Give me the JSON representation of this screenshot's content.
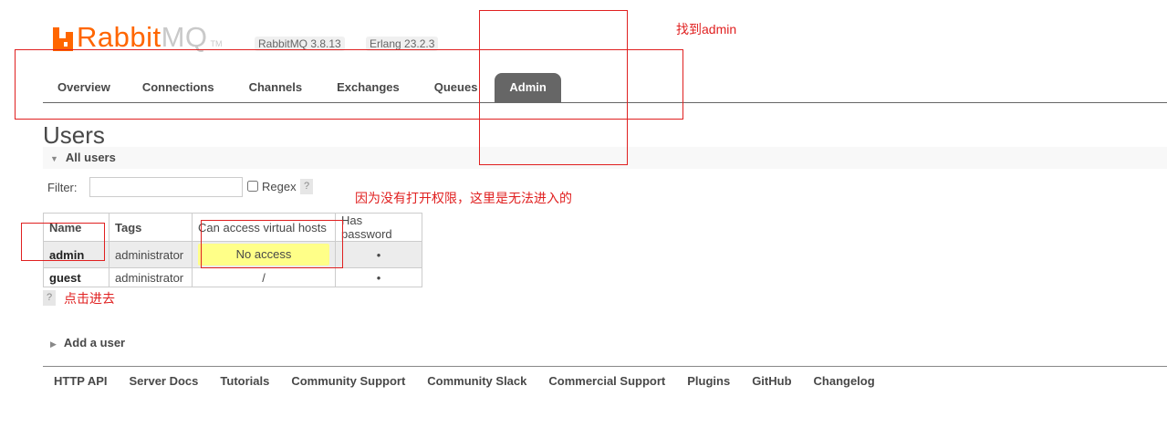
{
  "header": {
    "logo_main": "Rabbit",
    "logo_mq": "MQ",
    "logo_tm": "TM",
    "version": "RabbitMQ 3.8.13",
    "erlang": "Erlang 23.2.3"
  },
  "tabs": [
    {
      "label": "Overview"
    },
    {
      "label": "Connections"
    },
    {
      "label": "Channels"
    },
    {
      "label": "Exchanges"
    },
    {
      "label": "Queues"
    },
    {
      "label": "Admin"
    }
  ],
  "page": {
    "title": "Users",
    "all_users": "All users",
    "filter_label": "Filter:",
    "filter_value": "",
    "regex_label": "Regex",
    "help": "?"
  },
  "table": {
    "headers": [
      "Name",
      "Tags",
      "Can access virtual hosts",
      "Has password"
    ],
    "rows": [
      {
        "name": "admin",
        "tags": "administrator",
        "vhosts": "No access",
        "has_password": "•"
      },
      {
        "name": "guest",
        "tags": "administrator",
        "vhosts": "/",
        "has_password": "•"
      }
    ]
  },
  "add_user": "Add a user",
  "footer": [
    "HTTP API",
    "Server Docs",
    "Tutorials",
    "Community Support",
    "Community Slack",
    "Commercial Support",
    "Plugins",
    "GitHub",
    "Changelog"
  ],
  "annotations": {
    "find_admin": "找到admin",
    "no_permission": "因为没有打开权限，这里是无法进入的",
    "click_enter": "点击进去",
    "color": "#e02020"
  },
  "colors": {
    "brand": "#ff6600",
    "active_tab": "#666666",
    "no_access_bg": "#ffff88"
  }
}
